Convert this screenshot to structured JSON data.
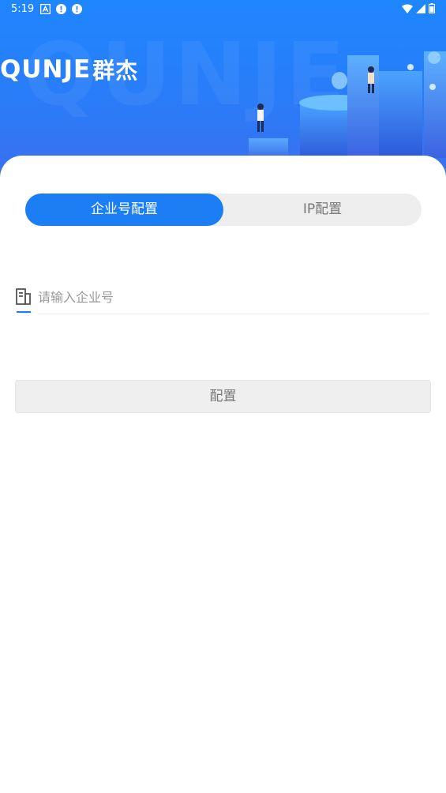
{
  "status_bar": {
    "time": "5:19",
    "left_icons": [
      "a-notification-icon",
      "alert-icon",
      "alert-icon"
    ],
    "right_icons": [
      "wifi-icon",
      "signal-icon",
      "battery-icon"
    ]
  },
  "header": {
    "watermark": "QUNJE",
    "logo_latin": "QUNJE",
    "logo_cn": "群杰",
    "background_color": "#1e86ff"
  },
  "tabs": [
    {
      "label": "企业号配置",
      "active": true
    },
    {
      "label": "IP配置",
      "active": false
    }
  ],
  "enterprise_field": {
    "icon": "building-icon",
    "placeholder": "请输入企业号",
    "value": ""
  },
  "submit_button": {
    "label": "配置"
  },
  "colors": {
    "accent": "#1b7ef5",
    "button_bg": "#efefef",
    "tab_bg": "#eeeeee"
  }
}
